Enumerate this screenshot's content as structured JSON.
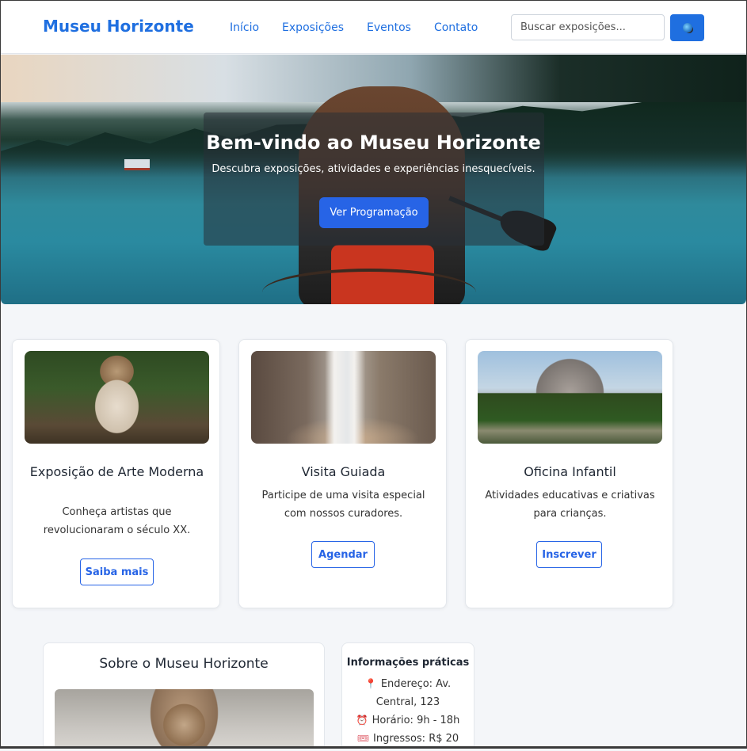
{
  "header": {
    "logo": "Museu Horizonte",
    "nav": [
      "Início",
      "Exposições",
      "Eventos",
      "Contato"
    ],
    "search_placeholder": "Buscar exposições..."
  },
  "hero": {
    "title": "Bem-vindo ao Museu Horizonte",
    "subtitle": "Descubra exposições, atividades e experiências inesquecíveis.",
    "button": "Ver Programação"
  },
  "cards": [
    {
      "title": "Exposição de Arte Moderna",
      "text": "Conheça artistas que revolucionaram o século XX.",
      "button": "Saiba mais",
      "image": "pug-in-blanket-photo"
    },
    {
      "title": "Visita Guiada",
      "text": "Participe de uma visita especial com nossos curadores.",
      "button": "Agendar",
      "image": "waterfall-rainbow-photo"
    },
    {
      "title": "Oficina Infantil",
      "text": "Atividades educativas e criativas para crianças.",
      "button": "Inscrever",
      "image": "forest-mountains-photo"
    }
  ],
  "about": {
    "title": "Sobre o Museu Horizonte",
    "image": "pug-under-blanket-photo"
  },
  "info": {
    "title": "Informações práticas",
    "address_line1": "Endereço: Av.",
    "address_line2": "Central, 123",
    "hours": "Horário: 9h - 18h",
    "tickets": "Ingressos: R$ 20"
  },
  "icons": {
    "search": "search-icon",
    "address": "pin-icon",
    "hours": "alarm-clock-icon",
    "tickets": "ticket-icon"
  },
  "colors": {
    "primary": "#1f6fe0",
    "button": "#2764e6",
    "background": "#f4f6f9"
  }
}
